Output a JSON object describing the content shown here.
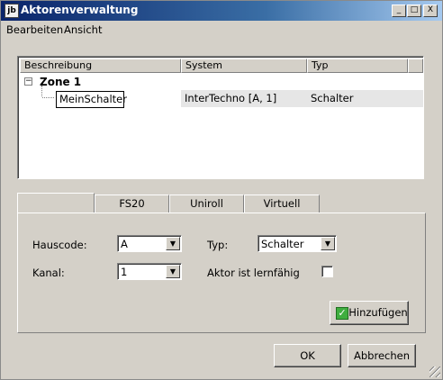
{
  "window": {
    "title": "Aktorenverwaltung",
    "app_icon": "jb"
  },
  "title_buttons": {
    "minimize": "_",
    "maximize": "□",
    "close": "X"
  },
  "menu": [
    "Bearbeiten",
    "Ansicht"
  ],
  "list": {
    "columns": [
      "Beschreibung",
      "System",
      "Typ"
    ],
    "zone": {
      "toggle": "−",
      "label": "Zone 1"
    },
    "rows": [
      {
        "description": "MeinSchalter",
        "system": "InterTechno [A, 1]",
        "type": "Schalter"
      }
    ]
  },
  "tabs": [
    "",
    "FS20",
    "Uniroll",
    "Virtuell"
  ],
  "form": {
    "hauscode_label": "Hauscode:",
    "hauscode_value": "A",
    "typ_label": "Typ:",
    "typ_value": "Schalter",
    "kanal_label": "Kanal:",
    "kanal_value": "1",
    "lernfaehig_label": "Aktor ist lernfähig",
    "lernfaehig_checked": false,
    "add_button": "Hinzufügen",
    "combo_arrow": "▼"
  },
  "buttons": {
    "ok": "OK",
    "cancel": "Abbrechen"
  },
  "colors": {
    "titlebar_start": "#0a246a",
    "titlebar_end": "#a6caf0",
    "face": "#d4d0c8",
    "add_icon": "#3fae3f"
  }
}
